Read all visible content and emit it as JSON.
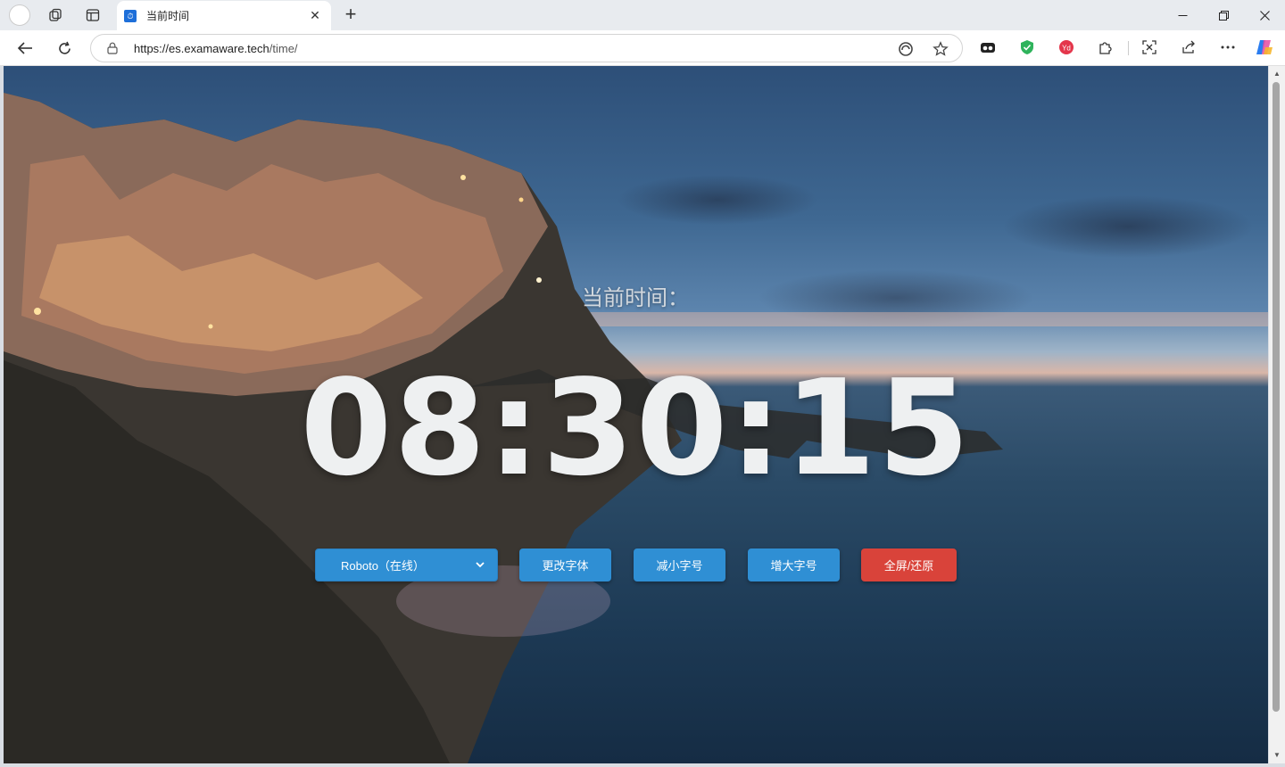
{
  "browser": {
    "tab_title": "当前时间",
    "url_host": "https://es.examaware.tech",
    "url_path": "/time/"
  },
  "page": {
    "label": "当前时间：",
    "time": "08:30:15",
    "font_select": {
      "selected": "Roboto（在线）"
    },
    "buttons": {
      "change_font": "更改字体",
      "decrease": "减小字号",
      "increase": "增大字号",
      "fullscreen": "全屏/还原"
    }
  },
  "colors": {
    "button_blue": "#2f8fd4",
    "button_red": "#d9433a",
    "clock_text": "#eef0f1"
  }
}
